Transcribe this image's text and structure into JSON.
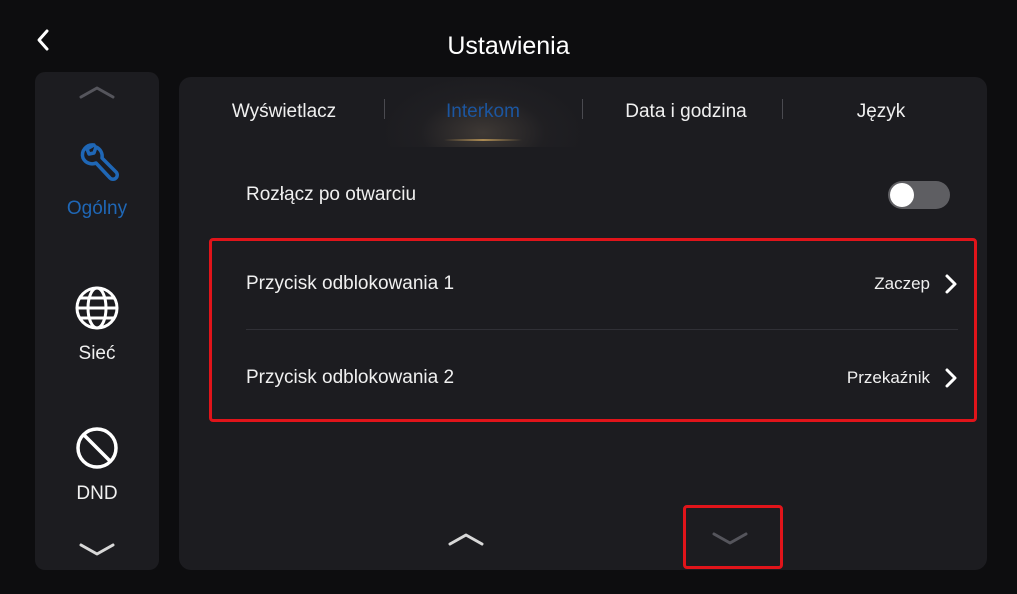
{
  "header": {
    "title": "Ustawienia",
    "back_icon": "chevron-left-icon"
  },
  "sidebar": {
    "items": [
      {
        "label": "Ogólny",
        "icon": "wrench-icon",
        "active": true
      },
      {
        "label": "Sieć",
        "icon": "globe-icon",
        "active": false
      },
      {
        "label": "DND",
        "icon": "do-not-disturb-icon",
        "active": false
      }
    ],
    "accent_color": "#1f67b6"
  },
  "tabs": [
    {
      "label": "Wyświetlacz",
      "active": false
    },
    {
      "label": "Interkom",
      "active": true
    },
    {
      "label": "Data i godzina",
      "active": false
    },
    {
      "label": "Język",
      "active": false
    }
  ],
  "settings": {
    "disconnect": {
      "label": "Rozłącz po otwarciu",
      "enabled": false
    },
    "unlock1": {
      "label": "Przycisk odblokowania 1",
      "value": "Zaczep"
    },
    "unlock2": {
      "label": "Przycisk odblokowania 2",
      "value": "Przekaźnik"
    }
  },
  "colors": {
    "highlight": "#e0141a",
    "panel": "#1c1c20",
    "background": "#0d0d0f"
  }
}
